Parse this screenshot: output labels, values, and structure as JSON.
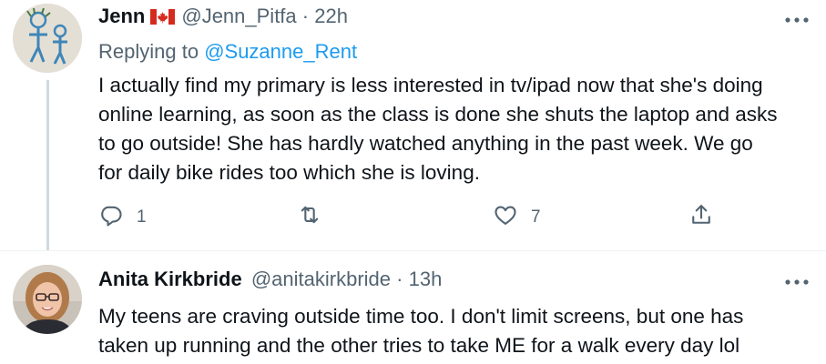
{
  "tweets": [
    {
      "name": "Jenn",
      "flag": "canada-flag",
      "handle": "@Jenn_Pitfa",
      "dot": "·",
      "time": "22h",
      "replying_prefix": "Replying to ",
      "replying_handle": "@Suzanne_Rent",
      "text": "I actually find my primary is less interested in tv/ipad now that she's doing\nonline learning, as soon as the class is done she shuts the laptop and asks\nto go outside! She has hardly watched anything in the past week. We go\nfor daily bike rides too which she is loving.",
      "actions": {
        "reply_count": "1",
        "retweet_count": "",
        "like_count": "7"
      }
    },
    {
      "name": "Anita Kirkbride",
      "handle": "@anitakirkbride",
      "dot": "·",
      "time": "13h",
      "text": "My teens are craving outside time too. I don't limit screens, but one has\ntaken up running and the other tries to take ME for a walk every day lol"
    }
  ],
  "colors": {
    "text": "#0f1419",
    "secondary": "#536471",
    "link": "#1d9bf0",
    "thread_line": "#cfd9de"
  },
  "icons": [
    "more-icon",
    "reply-icon",
    "retweet-icon",
    "like-icon",
    "share-icon"
  ]
}
